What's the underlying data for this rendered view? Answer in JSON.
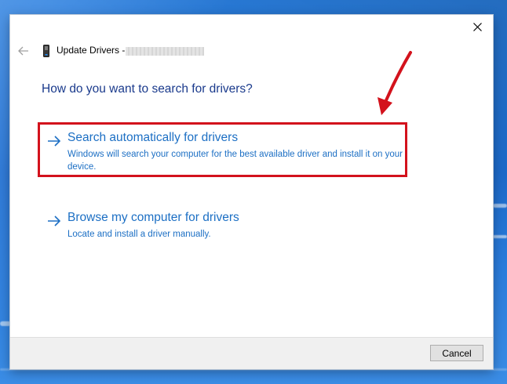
{
  "dialog": {
    "title": "Update Drivers -",
    "heading": "How do you want to search for drivers?",
    "options": [
      {
        "title": "Search automatically for drivers",
        "description": "Windows will search your computer for the best available driver and install it on your device."
      },
      {
        "title": "Browse my computer for drivers",
        "description": "Locate and install a driver manually."
      }
    ],
    "cancel_label": "Cancel"
  },
  "icons": {
    "close": "close-icon",
    "back": "back-arrow-icon",
    "device": "device-icon",
    "option_arrow": "arrow-right-icon"
  },
  "colors": {
    "heading": "#1a3a8c",
    "link": "#1c6fc4",
    "highlight": "#d3121c",
    "desktop": "#1e6fd4"
  }
}
